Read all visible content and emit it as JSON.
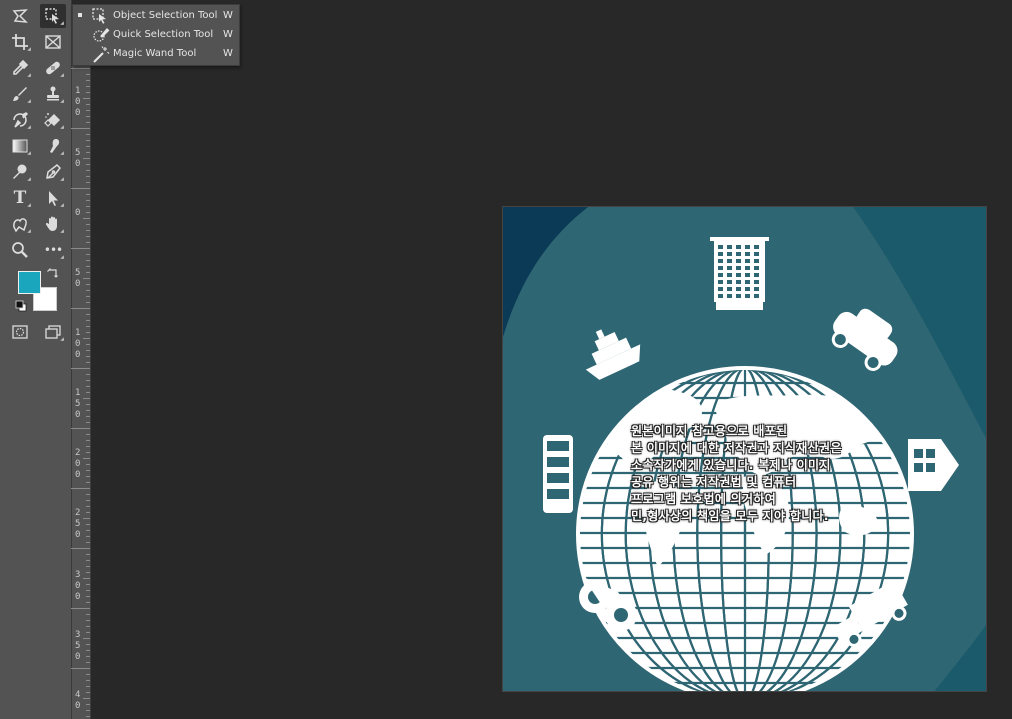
{
  "toolbar": {
    "tools": [
      {
        "name": "lasso-tool"
      },
      {
        "name": "object-selection-tool",
        "active": true
      },
      {
        "name": "crop-tool"
      },
      {
        "name": "frame-tool"
      },
      {
        "name": "eyedropper-tool"
      },
      {
        "name": "spot-healing-tool"
      },
      {
        "name": "brush-tool"
      },
      {
        "name": "clone-stamp-tool"
      },
      {
        "name": "history-brush-tool"
      },
      {
        "name": "eraser-tool"
      },
      {
        "name": "gradient-tool"
      },
      {
        "name": "smudge-tool"
      },
      {
        "name": "dodge-tool"
      },
      {
        "name": "pen-tool"
      },
      {
        "name": "type-tool",
        "glyph": "T"
      },
      {
        "name": "path-selection-tool"
      },
      {
        "name": "custom-shape-tool"
      },
      {
        "name": "hand-tool"
      },
      {
        "name": "zoom-tool"
      },
      {
        "name": "more-tools",
        "glyph": "•••"
      }
    ],
    "foreground_color": "#1aa6bd",
    "background_color": "#ffffff"
  },
  "flyout": {
    "items": [
      {
        "label": "Object Selection Tool",
        "shortcut": "W",
        "selected": true
      },
      {
        "label": "Quick Selection Tool",
        "shortcut": "W",
        "selected": false
      },
      {
        "label": "Magic Wand Tool",
        "shortcut": "W",
        "selected": false
      }
    ]
  },
  "ruler": {
    "labels": [
      "1\n0\n0",
      "5\n0",
      "0",
      "5\n0",
      "1\n0\n0",
      "1\n5\n0",
      "2\n0\n0",
      "2\n5\n0",
      "3\n0\n0",
      "3\n5\n0",
      "4\n0"
    ]
  },
  "document": {
    "background": "#2f6673",
    "watermark_lines": [
      "원본이미지 참고용으로 배포된",
      "본 이미지에 대한 저작권과 지식재산권은",
      "소속작가에게 있습니다. 복제나 이미지",
      "공유 행위는 저작권법 및 컴퓨터",
      "프로그램 보호법에 의거하여",
      "민,형사상의 책임을 모두 지야 합니다."
    ]
  }
}
